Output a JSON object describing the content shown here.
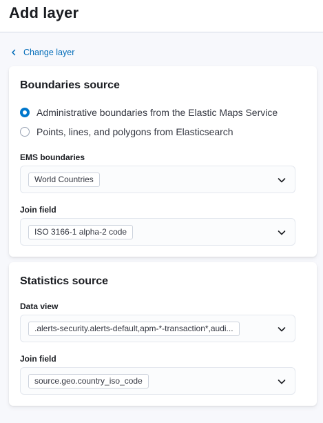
{
  "header": {
    "title": "Add layer"
  },
  "back_link": {
    "label": "Change layer",
    "icon": "chevron-left-icon"
  },
  "boundaries": {
    "title": "Boundaries source",
    "options": [
      {
        "label": "Administrative boundaries from the Elastic Maps Service",
        "checked": true
      },
      {
        "label": "Points, lines, and polygons from Elasticsearch",
        "checked": false
      }
    ],
    "ems_label": "EMS boundaries",
    "ems_value": "World Countries",
    "join_label": "Join field",
    "join_value": "ISO 3166-1 alpha-2 code"
  },
  "statistics": {
    "title": "Statistics source",
    "data_view_label": "Data view",
    "data_view_value": ".alerts-security.alerts-default,apm-*-transaction*,audi...",
    "join_label": "Join field",
    "join_value": "source.geo.country_iso_code"
  },
  "colors": {
    "accent": "#0077cc",
    "link": "#006bb8"
  }
}
